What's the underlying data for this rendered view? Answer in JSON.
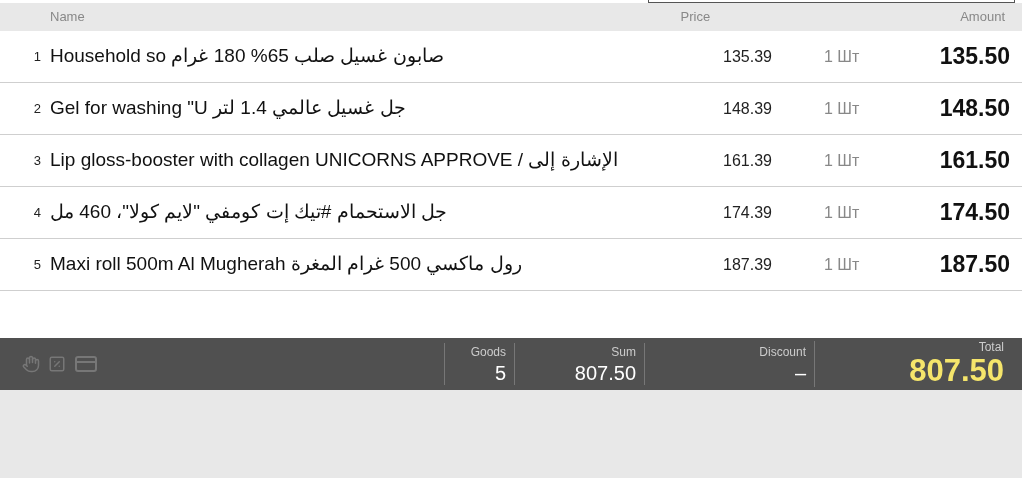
{
  "columns": {
    "name": "Name",
    "price": "Price",
    "amount": "Amount"
  },
  "rows": [
    {
      "index": "1",
      "name": "Household so صابون غسيل صلب 65% 180 غرام",
      "price": "135.39",
      "qty": "1 Шт",
      "amount": "135.50"
    },
    {
      "index": "2",
      "name": "Gel for washing \"U جل غسيل عالمي 1.4 لتر",
      "price": "148.39",
      "qty": "1 Шт",
      "amount": "148.50"
    },
    {
      "index": "3",
      "name": "Lip gloss-booster with collagen UNICORNS APPROVE / الإشارة إلى",
      "price": "161.39",
      "qty": "1 Шт",
      "amount": "161.50"
    },
    {
      "index": "4",
      "name": "جل الاستحمام #تيك إت كومفي \"لايم كولا\"، 460 مل",
      "price": "174.39",
      "qty": "1 Шт",
      "amount": "174.50"
    },
    {
      "index": "5",
      "name": "Maxi roll 500m Al Mugherah رول ماكسي 500 غرام المغرة",
      "price": "187.39",
      "qty": "1 Шт",
      "amount": "187.50"
    }
  ],
  "footer": {
    "goods_label": "Goods",
    "goods": "5",
    "sum_label": "Sum",
    "sum": "807.50",
    "discount_label": "Discount",
    "discount": "–",
    "total_label": "Total",
    "total": "807.50"
  }
}
